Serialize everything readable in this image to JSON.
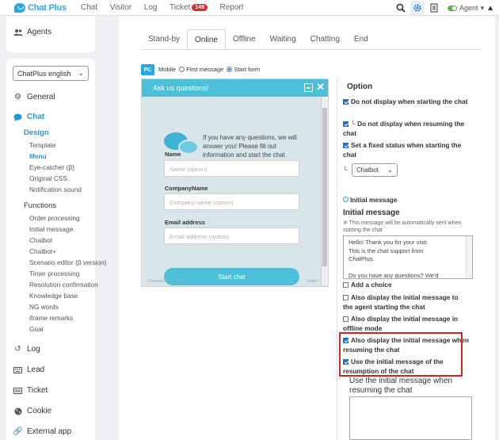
{
  "app": {
    "name": "Chat Plus"
  },
  "topnav": {
    "items": [
      "Chat",
      "Visitor",
      "Log",
      "Ticket",
      "Report"
    ],
    "ticket_badge": "149",
    "agent_label": "Agent",
    "accent": "#2aa7e0",
    "icons": [
      "search-icon",
      "gear-icon",
      "document-icon",
      "status-toggle",
      "warning-icon"
    ]
  },
  "sidebar": {
    "agents": "Agents",
    "site_select": "ChatPlus english",
    "general": "General",
    "chat": "Chat",
    "design": "Design",
    "design_items": [
      "Template",
      "Menu",
      "Eye-catcher (β)",
      "Original CSS",
      "Notification sound"
    ],
    "functions": "Functions",
    "function_items": [
      "Order processing",
      "Initial message",
      "Chatbot",
      "Chatbot+",
      "Scenario editor (β version)",
      "Timer processing",
      "Resolution confirmation",
      "Knowledge base",
      "NG words",
      "iframe remarks",
      "Goal"
    ],
    "bottom_items": [
      "Log",
      "Lead",
      "Ticket",
      "Cookie",
      "External app"
    ]
  },
  "tabs": [
    "Stand-by",
    "Online",
    "Offline",
    "Waiting",
    "Chatting",
    "End"
  ],
  "preview": {
    "pc": "PC",
    "mobile": "Mobile",
    "first_message": "First message",
    "start_form": "Start form",
    "header": "Ask us questions!",
    "intro": "If you have any questions, we will answer you! Please fill out information and start the chat.",
    "fields": [
      {
        "label": "Name",
        "placeholder": "Name (option)"
      },
      {
        "label": "CompanyName",
        "placeholder": "Company name (option)"
      },
      {
        "label": "Email address",
        "placeholder": "Email address (option)"
      }
    ],
    "button": "Start chat",
    "footer": "Powered by Chat Plus",
    "footer_right": "Option"
  },
  "options": {
    "title": "Option",
    "items": [
      "Do not display when starting the chat",
      "└ Do not display when resuming the chat",
      "Set a fixed status when starting the chat"
    ],
    "status_select": "Chatbot",
    "initial_radio": "Initial message",
    "initial_title": "Initial message",
    "initial_note": "※ This message will be automatically sent when starting the chat",
    "initial_text": [
      "Hello! Thank you for your visit.",
      "This is the chat support from",
      "ChatPlus.",
      "",
      "Do you have any questions? We'd"
    ],
    "checks": [
      "Add a choice",
      "Also display the initial message to the agent starting the chat",
      "Also display the initial message in offline mode",
      "Also display the initial message when resuming the chat",
      "Use the initial message of the resumption of the chat"
    ],
    "use_label": "Use the initial message when resuming the chat"
  }
}
